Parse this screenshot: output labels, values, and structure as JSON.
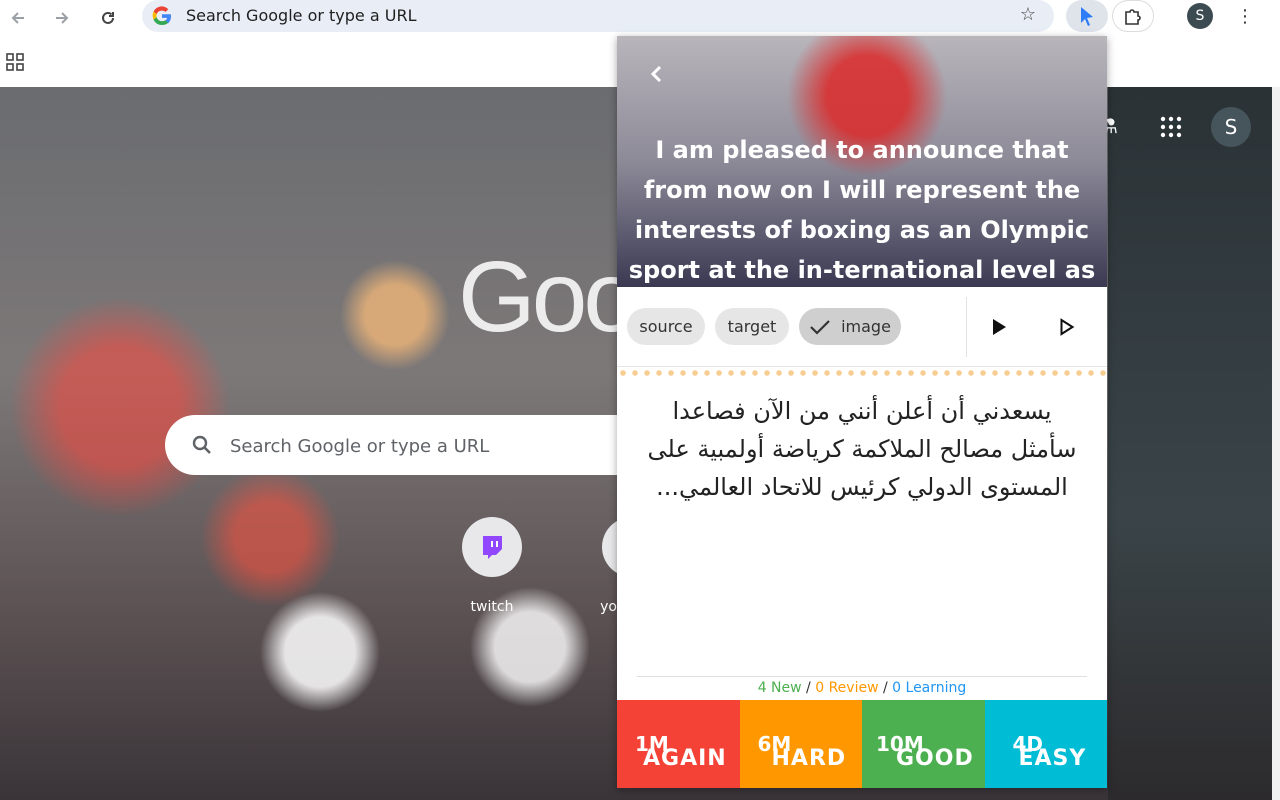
{
  "browser": {
    "omnibox_placeholder": "Search Google or type a URL",
    "profile_initial": "S"
  },
  "newtab": {
    "logo_text": "Goo",
    "search_placeholder": "Search Google or type a URL",
    "shortcuts": [
      {
        "label": "twitch"
      },
      {
        "label": "yo"
      }
    ],
    "profile_initial": "S"
  },
  "popup": {
    "source_text": "I am pleased to announce that from now on I will represent the interests of boxing as an Olympic sport at the in-ternational level as Chairman of the",
    "chips": [
      {
        "label": "source"
      },
      {
        "label": "target"
      },
      {
        "label": "image",
        "selected": true
      }
    ],
    "target_text": "يسعدني أن أعلن أنني من الآن فصاعدا سأمثل مصالح الملاكمة كرياضة أولمبية على المستوى الدولي كرئيس للاتحاد العالمي...",
    "stats": {
      "new": "4 New",
      "sep1": " / ",
      "review": "0 Review",
      "sep2": " / ",
      "learning": "0 Learning"
    },
    "answers": [
      {
        "time": "1M",
        "label": "AGAIN",
        "color": "#f44336"
      },
      {
        "time": "6M",
        "label": "HARD",
        "color": "#ff9800"
      },
      {
        "time": "10M",
        "label": "GOOD",
        "color": "#4caf50"
      },
      {
        "time": "4D",
        "label": "EASY",
        "color": "#00bcd4"
      }
    ]
  },
  "colors": {
    "stat_new": "#4caf50",
    "stat_review": "#ff9800",
    "stat_learning": "#2196f3"
  }
}
